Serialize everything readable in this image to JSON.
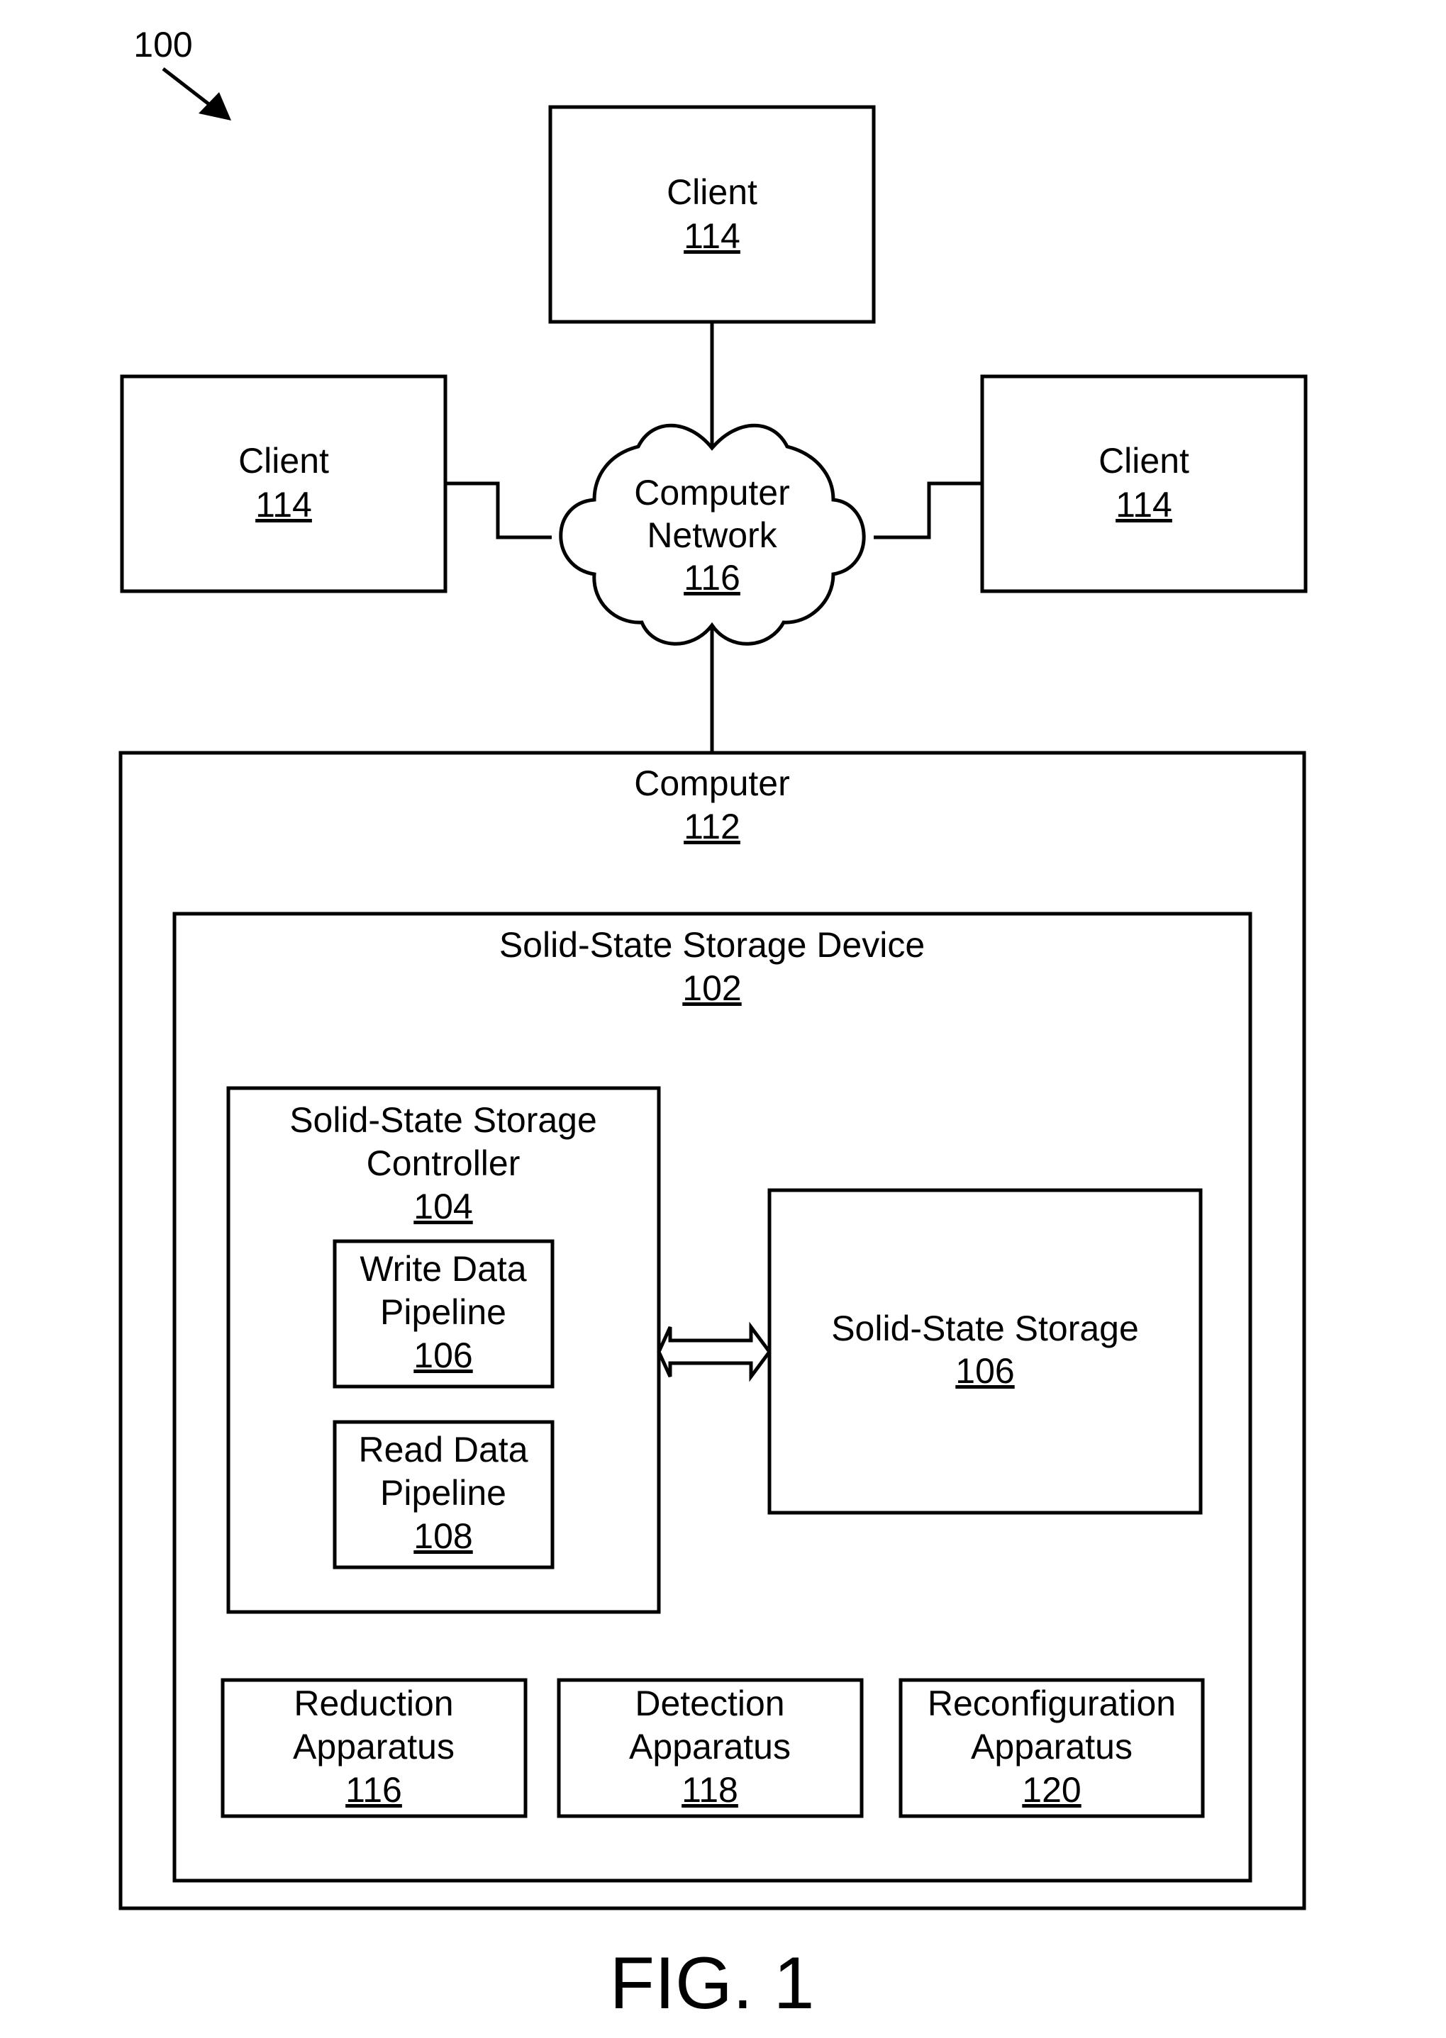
{
  "figure": {
    "reference_numeral": "100",
    "caption": "FIG. 1"
  },
  "clients": [
    {
      "label": "Client",
      "number": "114",
      "position": "top"
    },
    {
      "label": "Client",
      "number": "114",
      "position": "left"
    },
    {
      "label": "Client",
      "number": "114",
      "position": "right"
    }
  ],
  "network": {
    "line1": "Computer",
    "line2": "Network",
    "number": "116"
  },
  "computer": {
    "label": "Computer",
    "number": "112"
  },
  "ssd_device": {
    "label": "Solid-State Storage Device",
    "number": "102"
  },
  "controller": {
    "line1": "Solid-State Storage",
    "line2": "Controller",
    "number": "104"
  },
  "write_pipeline": {
    "line1": "Write Data",
    "line2": "Pipeline",
    "number": "106"
  },
  "read_pipeline": {
    "line1": "Read Data",
    "line2": "Pipeline",
    "number": "108"
  },
  "storage": {
    "label": "Solid-State Storage",
    "number": "106"
  },
  "apparatus": [
    {
      "line1": "Reduction",
      "line2": "Apparatus",
      "number": "116"
    },
    {
      "line1": "Detection",
      "line2": "Apparatus",
      "number": "118"
    },
    {
      "line1": "Reconfiguration",
      "line2": "Apparatus",
      "number": "120"
    }
  ]
}
